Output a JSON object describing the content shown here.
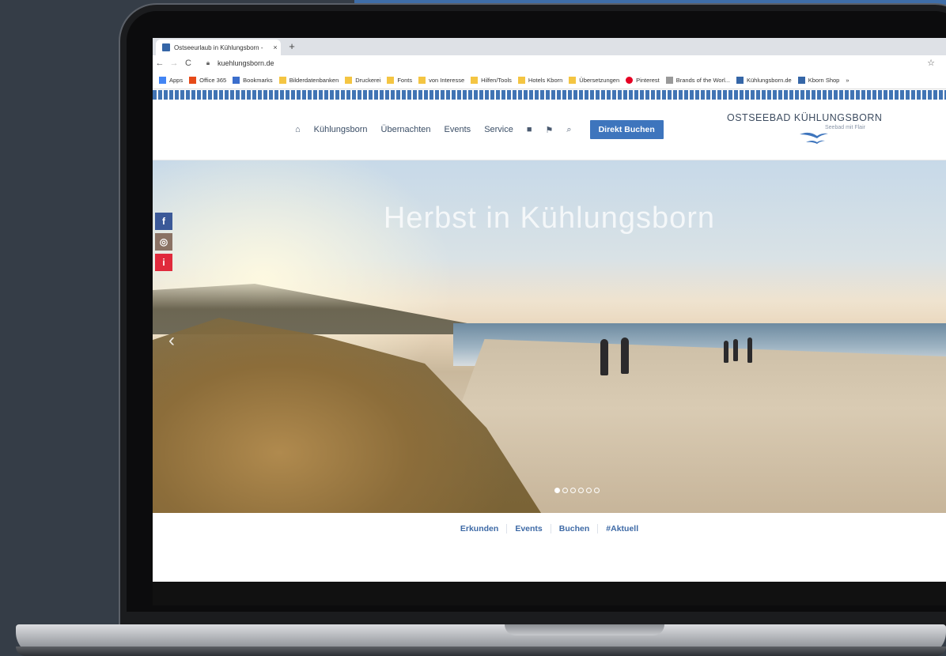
{
  "browser": {
    "tab_title": "Ostseeurlaub in Kühlungsborn -",
    "tab_close": "×",
    "new_tab": "+",
    "url": "kuehlungsborn.de",
    "bookmarks": [
      {
        "label": "Apps",
        "icon": "apps-grid-icon",
        "color": "#4285f4"
      },
      {
        "label": "Office 365",
        "icon": "office-icon",
        "color": "#e64a19"
      },
      {
        "label": "Bookmarks",
        "icon": "star-icon",
        "color": "#3b6ecc"
      },
      {
        "label": "Bilderdatenbanken",
        "icon": "folder-icon",
        "color": "#f4c542"
      },
      {
        "label": "Druckerei",
        "icon": "folder-icon",
        "color": "#f4c542"
      },
      {
        "label": "Fonts",
        "icon": "folder-icon",
        "color": "#f4c542"
      },
      {
        "label": "von Interesse",
        "icon": "folder-icon",
        "color": "#f4c542"
      },
      {
        "label": "Hilfen/Tools",
        "icon": "folder-icon",
        "color": "#f4c542"
      },
      {
        "label": "Hotels Kborn",
        "icon": "folder-icon",
        "color": "#f4c542"
      },
      {
        "label": "Übersetzungen",
        "icon": "folder-icon",
        "color": "#f4c542"
      },
      {
        "label": "Pinterest",
        "icon": "pinterest-icon",
        "color": "#e60023"
      },
      {
        "label": "Brands of the Worl...",
        "icon": "brands-icon",
        "color": "#999999"
      },
      {
        "label": "Kühlungsborn.de",
        "icon": "kborn-favicon-icon",
        "color": "#3566a7"
      },
      {
        "label": "Kborn Shop",
        "icon": "kborn-favicon-icon",
        "color": "#3566a7"
      }
    ],
    "bookmarks_overflow": "»"
  },
  "site": {
    "nav": [
      "Kühlungsborn",
      "Übernachten",
      "Events",
      "Service"
    ],
    "book_button": "Direkt Buchen",
    "brand_name": "OSTSEEBAD KÜHLUNGSBORN",
    "brand_tagline": "Seebad mit Flair",
    "hero_title": "Herbst in Kühlungsborn",
    "carousel": {
      "total": 6,
      "active": 1
    },
    "social": [
      {
        "label": "f",
        "icon": "facebook-icon",
        "color": "#3b5998"
      },
      {
        "label": "◎",
        "icon": "instagram-icon",
        "color": "#8a7264"
      },
      {
        "label": "i",
        "icon": "info-icon",
        "color": "#e02a3c"
      }
    ],
    "subnav": [
      "Erkunden",
      "Events",
      "Buchen",
      "#Aktuell"
    ]
  },
  "colors": {
    "accent": "#3e75bd",
    "background": "#353d47"
  }
}
